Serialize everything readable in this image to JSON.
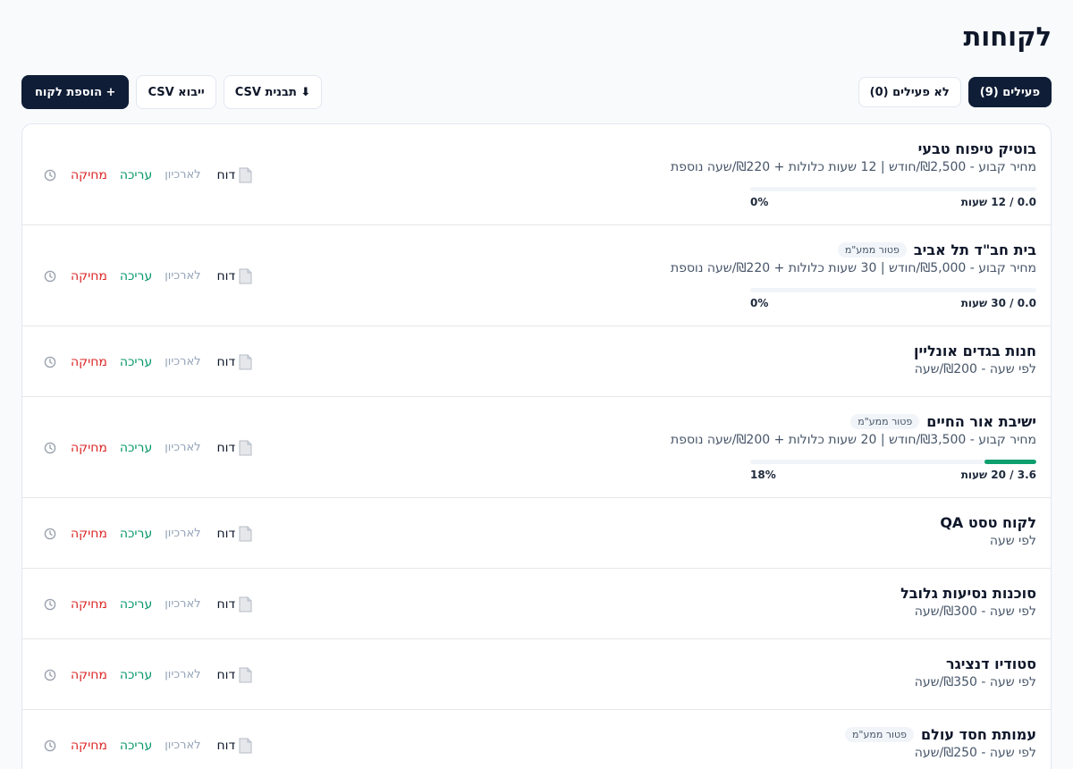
{
  "page": {
    "title": "לקוחות"
  },
  "toolbar": {
    "tabs": [
      {
        "label": "פעילים (9)",
        "active": true
      },
      {
        "label": "לא פעילים (0)",
        "active": false
      }
    ],
    "csv_template_label": "⬇ תבנית CSV",
    "import_label": "ייבוא CSV",
    "add_label": "+ הוספת לקוח"
  },
  "row_actions": {
    "report": "דוח",
    "archive": "לארכיון",
    "edit": "עריכה",
    "delete": "מחיקה"
  },
  "clients": [
    {
      "name": "בוטיק טיפוח טבעי",
      "badge": "",
      "price": "מחיר קבוע - ₪2,500/חודש | 12 שעות כלולות + ₪220/שעה נוספת",
      "progress": {
        "hours_text": "0.0 / 12 שעות",
        "percent_text": "0%",
        "fraction": 0
      }
    },
    {
      "name": "בית חב\"ד תל אביב",
      "badge": "פטור ממע\"מ",
      "price": "מחיר קבוע - ₪5,000/חודש | 30 שעות כלולות + ₪220/שעה נוספת",
      "progress": {
        "hours_text": "0.0 / 30 שעות",
        "percent_text": "0%",
        "fraction": 0
      }
    },
    {
      "name": "חנות בגדים אונליין",
      "badge": "",
      "price": "לפי שעה - ₪200/שעה",
      "progress": null
    },
    {
      "name": "ישיבת אור החיים",
      "badge": "פטור ממע\"מ",
      "price": "מחיר קבוע - ₪3,500/חודש | 20 שעות כלולות + ₪200/שעה נוספת",
      "progress": {
        "hours_text": "3.6 / 20 שעות",
        "percent_text": "18%",
        "fraction": 0.18
      }
    },
    {
      "name": "לקוח טסט QA",
      "badge": "",
      "price": "לפי שעה",
      "progress": null
    },
    {
      "name": "סוכנות נסיעות גלובל",
      "badge": "",
      "price": "לפי שעה - ₪300/שעה",
      "progress": null
    },
    {
      "name": "סטודיו דנציגר",
      "badge": "",
      "price": "לפי שעה - ₪350/שעה",
      "progress": null
    },
    {
      "name": "עמותת חסד עולם",
      "badge": "פטור ממע\"מ",
      "price": "לפי שעה - ₪250/שעה",
      "progress": null
    }
  ],
  "colors": {
    "primary": "#0f1d36",
    "delete": "#dc2626",
    "edit": "#059669",
    "archive": "#94a3b8",
    "progress": "#0e9f6e"
  }
}
